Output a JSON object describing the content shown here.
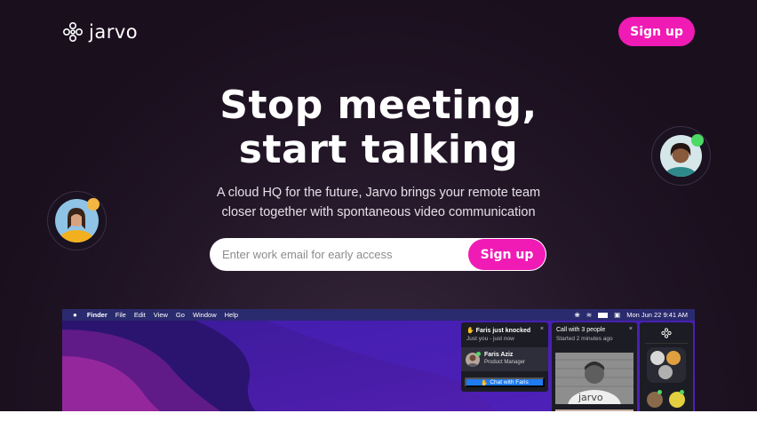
{
  "brand": {
    "name": "jarvo",
    "accent": "#f01bb5"
  },
  "header": {
    "signup_label": "Sign up"
  },
  "hero": {
    "headline_line1": "Stop meeting,",
    "headline_line2": "start talking",
    "subtitle": "A cloud HQ for the future, Jarvo brings your remote team closer together with spontaneous video communication",
    "email_placeholder": "Enter work email for early access",
    "signup_label": "Sign up"
  },
  "menubar": {
    "items": [
      "Finder",
      "File",
      "Edit",
      "View",
      "Go",
      "Window",
      "Help"
    ],
    "datetime": "Mon Jun 22  9:41 AM"
  },
  "knock_panel": {
    "title": "Faris just knocked",
    "time": "Just you - just now",
    "close": "×",
    "person_name": "Faris Aziz",
    "person_role": "Product Manager",
    "chat_button": "Chat with Faris"
  },
  "call_panel": {
    "title": "Call with 3 people",
    "time": "Started 2 minutes ago",
    "close": "×",
    "shirt_text": "jarvo"
  }
}
